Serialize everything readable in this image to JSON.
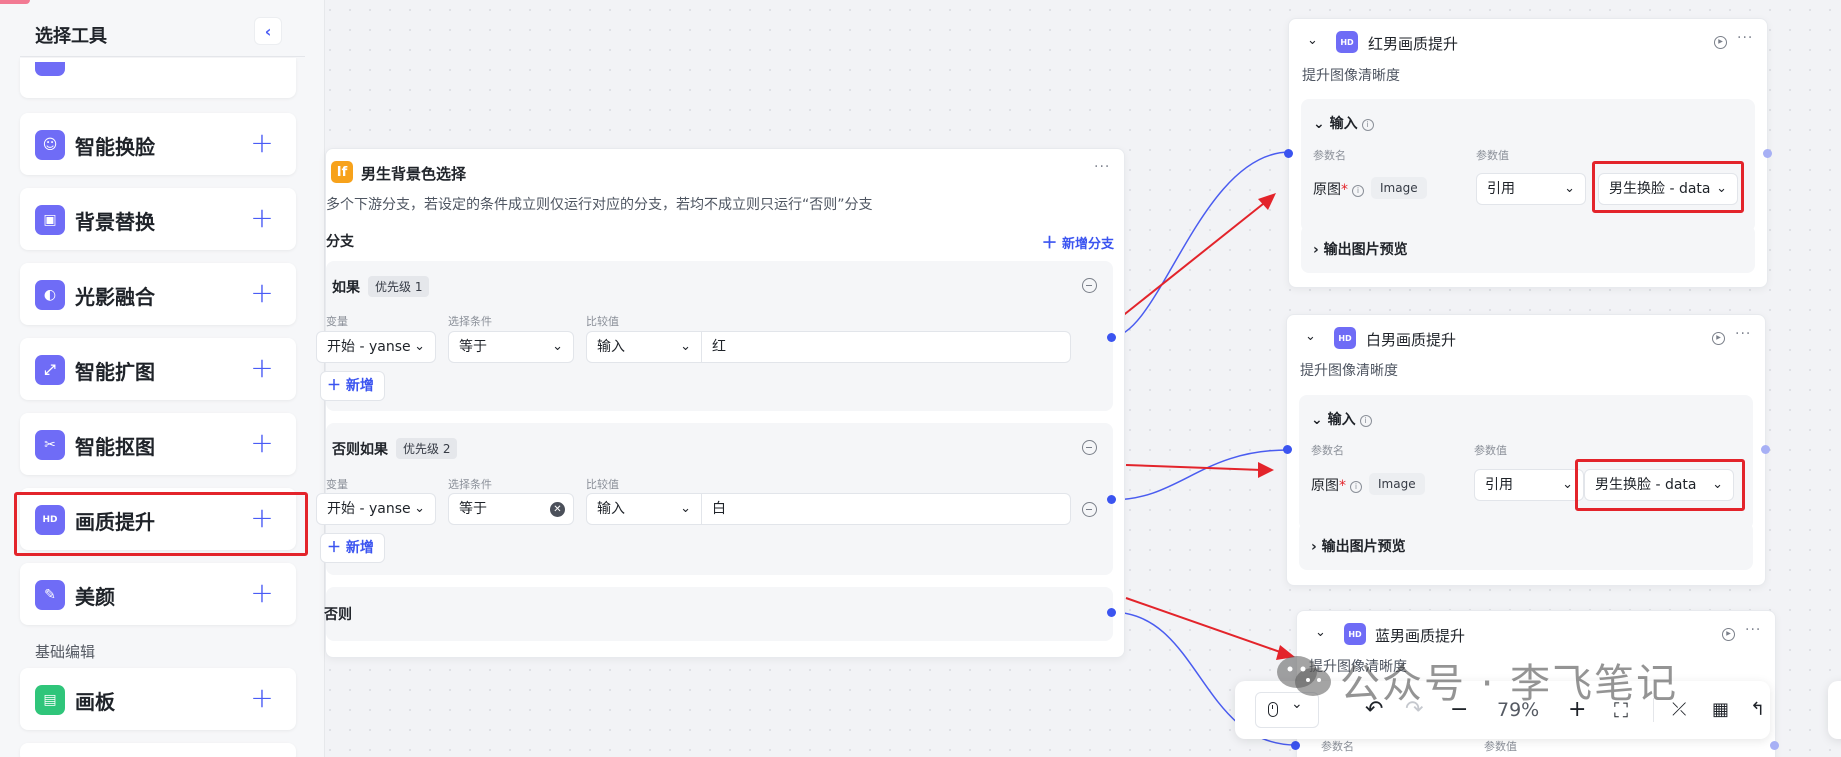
{
  "sidebar": {
    "title": "选择工具",
    "items": [
      {
        "label": "智能换脸",
        "icon": "face-swap-icon"
      },
      {
        "label": "背景替换",
        "icon": "background-replace-icon"
      },
      {
        "label": "光影融合",
        "icon": "light-blend-icon"
      },
      {
        "label": "智能扩图",
        "icon": "expand-image-icon"
      },
      {
        "label": "智能抠图",
        "icon": "cutout-icon"
      },
      {
        "label": "画质提升",
        "icon": "hd-icon"
      },
      {
        "label": "美颜",
        "icon": "beauty-icon"
      }
    ],
    "section_basic": "基础编辑",
    "basic_items": [
      {
        "label": "画板",
        "icon": "canvas-board-icon"
      }
    ],
    "highlight_color": "#e3242b",
    "accent_color": "#4a5cf5"
  },
  "condition_node": {
    "title": "男生背景色选择",
    "icon_text": "If",
    "description": "多个下游分支，若设定的条件成立则仅运行对应的分支，若均不成立则只运行“否则”分支",
    "branch_header": "分支",
    "add_branch": "新增分支",
    "col_var": "变量",
    "col_cond": "选择条件",
    "col_compare": "比较值",
    "branches": [
      {
        "title": "如果",
        "priority": "优先级 1",
        "variable": "开始 - yanse",
        "condition": "等于",
        "input_type": "输入",
        "value": "红",
        "add": "新增"
      },
      {
        "title": "否则如果",
        "priority": "优先级 2",
        "variable": "开始 - yanse",
        "condition": "等于",
        "input_type": "输入",
        "value": "白",
        "add": "新增"
      }
    ],
    "else_label": "否则"
  },
  "quality_nodes": [
    {
      "title": "红男画质提升",
      "description": "提升图像清晰度",
      "input_section": "输入",
      "param_col": "参数名",
      "value_col": "参数值",
      "param_name": "原图",
      "type_tag": "Image",
      "ref_mode": "引用",
      "ref_value": "男生换脸 - data",
      "output_preview": "输出图片预览"
    },
    {
      "title": "白男画质提升",
      "description": "提升图像清晰度",
      "input_section": "输入",
      "param_col": "参数名",
      "value_col": "参数值",
      "param_name": "原图",
      "type_tag": "Image",
      "ref_mode": "引用",
      "ref_value": "男生换脸 - data",
      "output_preview": "输出图片预览"
    },
    {
      "title": "蓝男画质提升",
      "description": "提升图像清晰度",
      "param_col": "参数名",
      "value_col": "参数值"
    }
  ],
  "toolbar": {
    "zoom": "79%"
  },
  "watermark": "公众号 · 李飞笔记"
}
